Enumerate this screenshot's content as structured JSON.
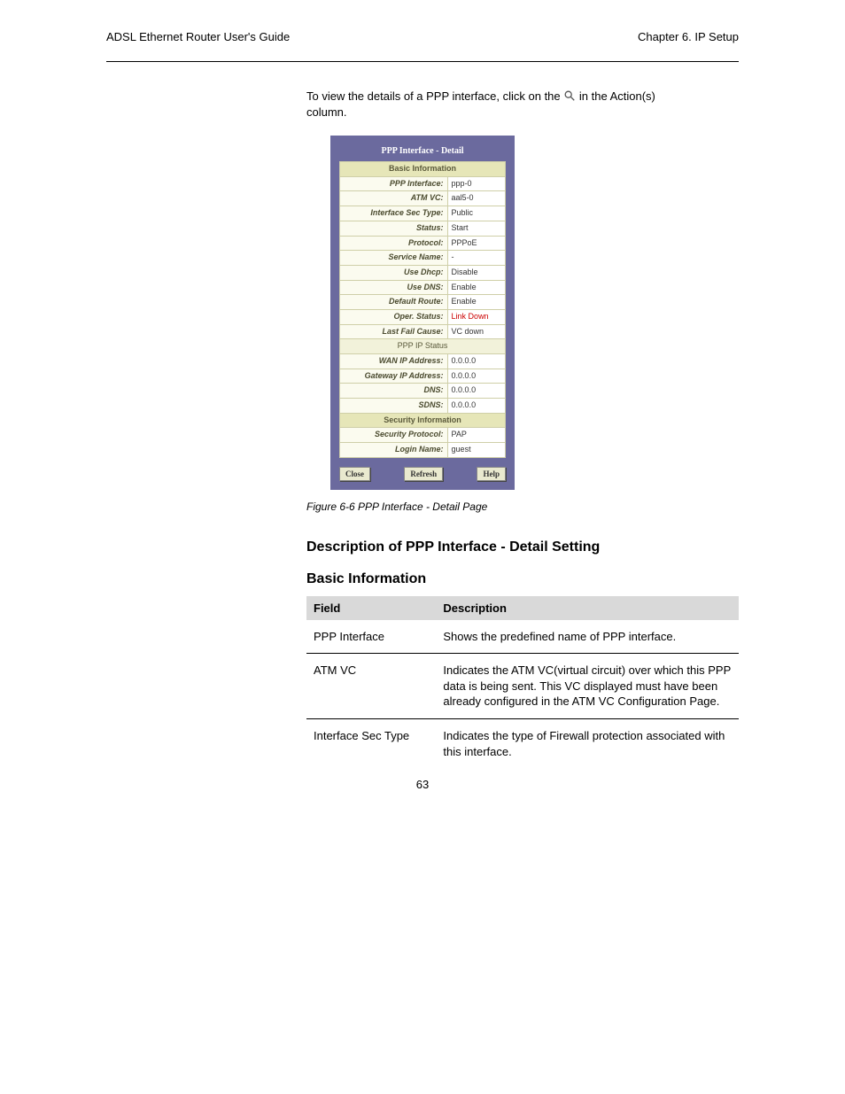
{
  "header": {
    "left": "ADSL Ethernet Router User's Guide",
    "right": "Chapter 6. IP Setup"
  },
  "intro_line1_prefix": "To view the details of a PPP interface, click on the ",
  "intro_line1_suffix": " in the Action(s)",
  "intro_line2": "column.",
  "panel": {
    "title": "PPP Interface - Detail",
    "section_basic": "Basic Information",
    "sub_ppp_ip": "PPP IP Status",
    "section_security": "Security Information",
    "rows": {
      "ppp_interface": {
        "label": "PPP Interface:",
        "value": "ppp-0"
      },
      "atm_vc": {
        "label": "ATM VC:",
        "value": "aal5-0"
      },
      "iface_sec_type": {
        "label": "Interface Sec Type:",
        "value": "Public"
      },
      "status": {
        "label": "Status:",
        "value": "Start"
      },
      "protocol": {
        "label": "Protocol:",
        "value": "PPPoE"
      },
      "service_name": {
        "label": "Service Name:",
        "value": "-"
      },
      "use_dhcp": {
        "label": "Use Dhcp:",
        "value": "Disable"
      },
      "use_dns": {
        "label": "Use DNS:",
        "value": "Enable"
      },
      "default_route": {
        "label": "Default Route:",
        "value": "Enable"
      },
      "oper_status": {
        "label": "Oper. Status:",
        "value": "Link Down"
      },
      "last_fail_cause": {
        "label": "Last Fail Cause:",
        "value": "VC down"
      },
      "wan_ip": {
        "label": "WAN IP Address:",
        "value": "0.0.0.0"
      },
      "gateway_ip": {
        "label": "Gateway IP Address:",
        "value": "0.0.0.0"
      },
      "dns": {
        "label": "DNS:",
        "value": "0.0.0.0"
      },
      "sdns": {
        "label": "SDNS:",
        "value": "0.0.0.0"
      },
      "sec_protocol": {
        "label": "Security Protocol:",
        "value": "PAP"
      },
      "login_name": {
        "label": "Login Name:",
        "value": "guest"
      }
    },
    "buttons": {
      "close": "Close",
      "refresh": "Refresh",
      "help": "Help"
    }
  },
  "figure_caption": "Figure 6-6 PPP Interface - Detail Page",
  "section_title": "Description of PPP Interface - Detail Setting",
  "sub_title_basic": "Basic Information",
  "def_table": {
    "head_field": "Field",
    "head_desc": "Description",
    "rows": [
      {
        "field": "PPP Interface",
        "desc": "Shows the predefined name of PPP interface."
      },
      {
        "field": "ATM VC",
        "desc": "Indicates the ATM VC(virtual circuit) over which this PPP data is being sent. This VC displayed must have been already configured in the ATM VC Configuration Page."
      },
      {
        "field": "Interface Sec Type",
        "desc": "Indicates the type of Firewall protection associated with this interface."
      }
    ]
  },
  "page_number": "63"
}
